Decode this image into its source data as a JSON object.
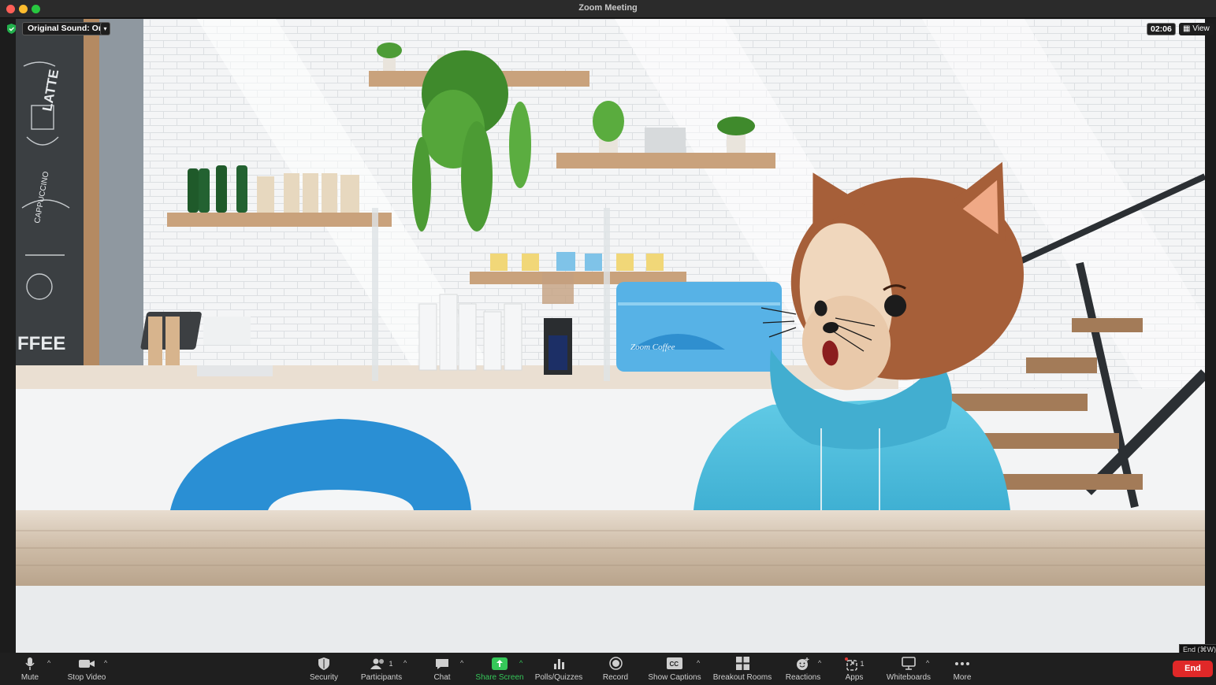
{
  "window": {
    "title": "Zoom Meeting"
  },
  "overlay": {
    "original_sound": "Original Sound: On",
    "timer": "02:06",
    "view_label": "View",
    "end_tooltip": "End (⌘W)"
  },
  "scene": {
    "chalkboard_text": "LATTE",
    "chalkboard_text2": "CAPPUCCINO",
    "chalkboard_text3": "FFEE",
    "espresso_brand": "Zoom Coffee"
  },
  "toolbar": {
    "mute": "Mute",
    "stop_video": "Stop Video",
    "security": "Security",
    "participants": "Participants",
    "participants_count": "1",
    "chat": "Chat",
    "share_screen": "Share Screen",
    "polls": "Polls/Quizzes",
    "record": "Record",
    "show_captions": "Show Captions",
    "breakout_rooms": "Breakout Rooms",
    "reactions": "Reactions",
    "apps": "Apps",
    "apps_count": "1",
    "whiteboards": "Whiteboards",
    "more": "More",
    "end": "End"
  },
  "colors": {
    "share_green": "#35c759",
    "end_red": "#e02828",
    "hoodie": "#4fb9d6",
    "chair": "#2a8fd4"
  }
}
